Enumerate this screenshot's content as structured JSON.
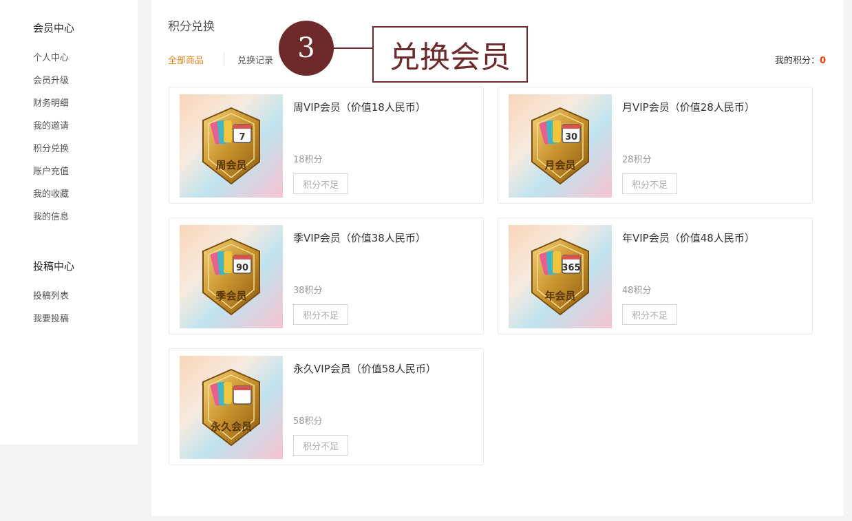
{
  "sidebar": {
    "member_center": {
      "title": "会员中心",
      "items": [
        "个人中心",
        "会员升级",
        "财务明细",
        "我的邀请",
        "积分兑换",
        "账户充值",
        "我的收藏",
        "我的信息"
      ]
    },
    "submission_center": {
      "title": "投稿中心",
      "items": [
        "投稿列表",
        "我要投稿"
      ]
    }
  },
  "main": {
    "title": "积分兑换",
    "tabs": [
      {
        "label": "全部商品",
        "active": true
      },
      {
        "label": "兑换记录",
        "active": false
      }
    ],
    "points_label": "我的积分：",
    "points_value": "0"
  },
  "products": [
    {
      "title": "周VIP会员（价值18人民币）",
      "price": "18积分",
      "button": "积分不足",
      "badge_text": "周会员",
      "badge_number": "7"
    },
    {
      "title": "月VIP会员（价值28人民币）",
      "price": "28积分",
      "button": "积分不足",
      "badge_text": "月会员",
      "badge_number": "30"
    },
    {
      "title": "季VIP会员（价值38人民币）",
      "price": "38积分",
      "button": "积分不足",
      "badge_text": "季会员",
      "badge_number": "90"
    },
    {
      "title": "年VIP会员（价值48人民币）",
      "price": "48积分",
      "button": "积分不足",
      "badge_text": "年会员",
      "badge_number": "365"
    },
    {
      "title": "永久VIP会员（价值58人民币）",
      "price": "58积分",
      "button": "积分不足",
      "badge_text": "永久会员",
      "badge_number": ""
    }
  ],
  "callout": {
    "number": "3",
    "label": "兑换会员"
  },
  "colors": {
    "accent": "#e8821f",
    "points_value": "#ff3b00",
    "callout": "#6e2a2a"
  }
}
